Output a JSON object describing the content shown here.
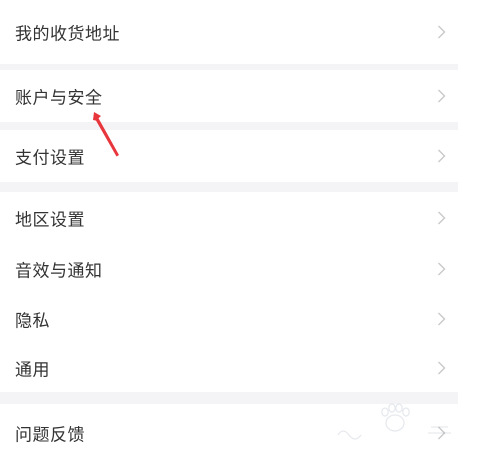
{
  "settings": {
    "groups": [
      {
        "items": [
          {
            "label": "我的收货地址",
            "icon": "chevron-right-icon"
          }
        ]
      },
      {
        "items": [
          {
            "label": "账户与安全",
            "icon": "chevron-right-icon"
          }
        ]
      },
      {
        "items": [
          {
            "label": "支付设置",
            "icon": "chevron-right-icon"
          }
        ]
      },
      {
        "items": [
          {
            "label": "地区设置",
            "icon": "chevron-right-icon"
          },
          {
            "label": "音效与通知",
            "icon": "chevron-right-icon"
          },
          {
            "label": "隐私",
            "icon": "chevron-right-icon"
          },
          {
            "label": "通用",
            "icon": "chevron-right-icon"
          }
        ]
      },
      {
        "items": [
          {
            "label": "问题反馈",
            "icon": "chevron-right-icon"
          }
        ]
      }
    ]
  },
  "annotation": {
    "arrow_color": "#e8363d"
  },
  "colors": {
    "background": "#f4f4f6",
    "row": "#ffffff",
    "text": "#333333",
    "chevron": "#c8c8c8"
  }
}
